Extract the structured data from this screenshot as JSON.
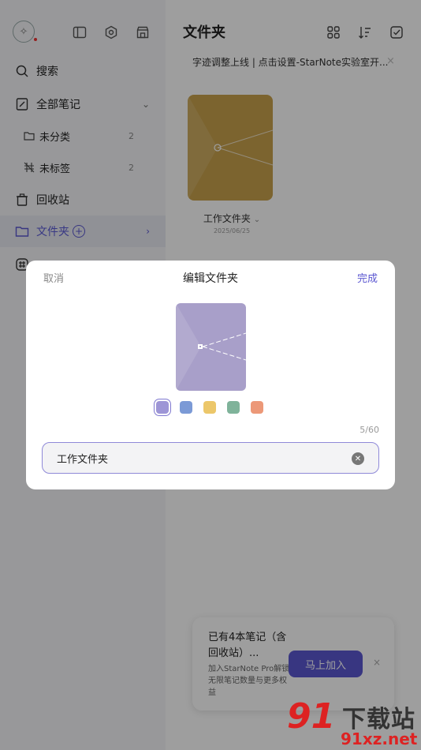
{
  "sidebar": {
    "search_label": "搜索",
    "all_notes_label": "全部笔记",
    "uncategorized_label": "未分类",
    "uncategorized_count": "2",
    "untagged_label": "未标签",
    "untagged_count": "2",
    "trash_label": "回收站",
    "folders_label": "文件夹"
  },
  "main": {
    "title": "文件夹",
    "notice": "字迹调整上线 | 点击设置-StarNote实验室开...",
    "notice_close": "×",
    "folder": {
      "name": "工作文件夹",
      "date": "2025/06/25",
      "color": "#c9a24c"
    }
  },
  "dialog": {
    "cancel_label": "取消",
    "title": "编辑文件夹",
    "done_label": "完成",
    "preview_color": "#a89fc9",
    "swatches": [
      "#9d95d6",
      "#7b9ad6",
      "#ecc76a",
      "#7fb39a",
      "#ec9878"
    ],
    "selected_swatch": 0,
    "char_counter": "5/60",
    "name_value": "工作文件夹"
  },
  "promo": {
    "title": "已有4本笔记（含回收站）...",
    "subtitle": "加入StarNote Pro解锁无限笔记数量与更多权益",
    "join_label": "马上加入",
    "close": "×"
  },
  "watermark": {
    "logo": "91",
    "cn": "下载站",
    "url": "91xz.net"
  },
  "colors": {
    "accent": "#5b57d1"
  }
}
